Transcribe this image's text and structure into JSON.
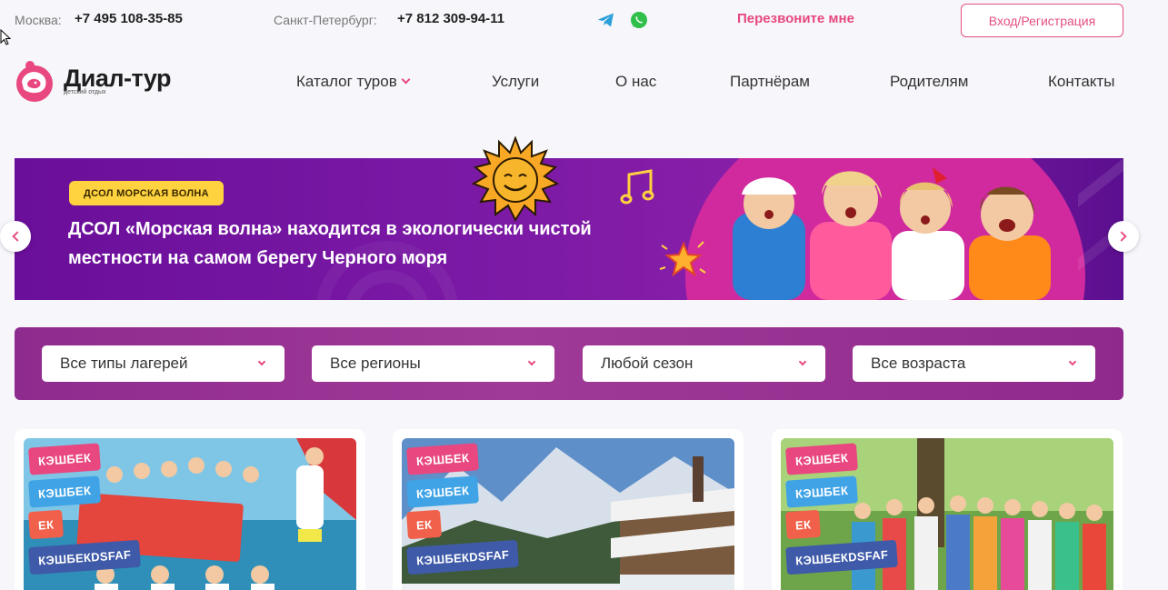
{
  "topbar": {
    "moscow_city": "Москва:",
    "moscow_phone": "+7 495 108-35-85",
    "spb_city": "Санкт-Петербург:",
    "spb_phone": "+7 812 309-94-11",
    "messengers": [
      {
        "icon": "telegram-icon",
        "color": "#2a9fd8"
      },
      {
        "icon": "whatsapp-icon",
        "color": "#2fbf4a"
      }
    ],
    "callback_label": "Перезвоните мне",
    "login_label": "Вход/Регистрация"
  },
  "logo": {
    "name": "Диал-тур",
    "tagline": "детский отдых"
  },
  "nav": {
    "items": [
      {
        "label": "Каталог туров",
        "has_dropdown": true
      },
      {
        "label": "Услуги"
      },
      {
        "label": "О нас"
      },
      {
        "label": "Партнёрам"
      },
      {
        "label": "Родителям"
      },
      {
        "label": "Контакты"
      }
    ]
  },
  "banner": {
    "tag": "ДСОЛ МОРСКАЯ ВОЛНА",
    "title": "ДСОЛ «Морская волна» находится в экологически чистой местности на самом берегу Черного моря"
  },
  "filters": {
    "selects": [
      {
        "value": "Все типы лагерей"
      },
      {
        "value": "Все регионы"
      },
      {
        "value": "Любой сезон"
      },
      {
        "value": "Все возраста"
      }
    ]
  },
  "cards": [
    {
      "badges": [
        "КЭШБЕК",
        "КЭШБЕК",
        "ЕК",
        "КЭШБЕКDSFAF"
      ]
    },
    {
      "badges": [
        "КЭШБЕК",
        "КЭШБЕК",
        "ЕК",
        "КЭШБЕКDSFAF"
      ]
    },
    {
      "badges": [
        "КЭШБЕК",
        "КЭШБЕК",
        "ЕК",
        "КЭШБЕКDSFAF"
      ]
    }
  ],
  "colors": {
    "accent": "#e8477f",
    "banner_purple": "#6a0f9a",
    "filter_bar": "#8e2b8e",
    "tag_yellow": "#ffd23f"
  }
}
